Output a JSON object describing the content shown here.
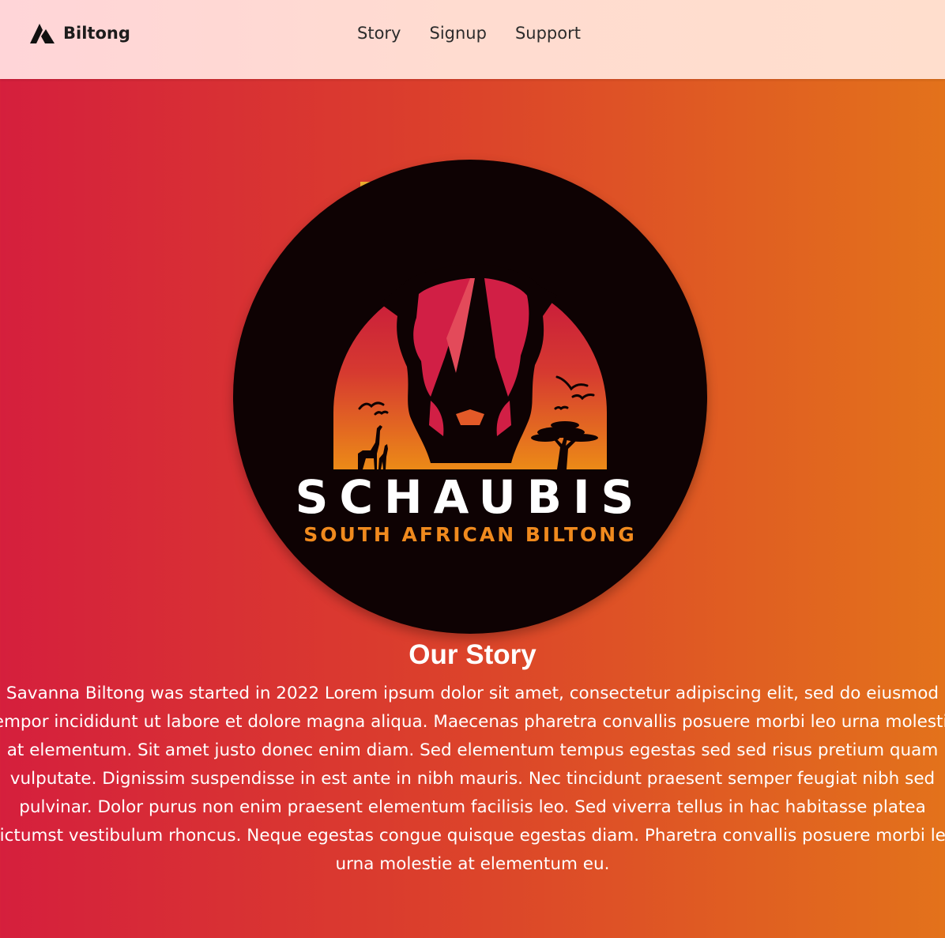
{
  "nav": {
    "brand": "Biltong",
    "links": [
      "Story",
      "Signup",
      "Support"
    ]
  },
  "logo": {
    "name": "SCHAUBIS",
    "tagline": "SOUTH AFRICAN BILTONG"
  },
  "story": {
    "title": "Our Story",
    "body": "Savanna Biltong was started in 2022 Lorem ipsum dolor sit amet, consectetur adipiscing elit, sed do eiusmod tempor incididunt ut labore et dolore magna aliqua. Maecenas pharetra convallis posuere morbi leo urna molestie at elementum. Sit amet justo donec enim diam. Sed elementum tempus egestas sed sed risus pretium quam vulputate. Dignissim suspendisse in est ante in nibh mauris. Nec tincidunt praesent semper feugiat nibh sed pulvinar. Dolor purus non enim praesent elementum facilisis leo. Sed viverra tellus in hac habitasse platea dictumst vestibulum rhoncus. Neque egestas congue quisque egestas diam. Pharetra convallis posuere morbi leo urna molestie at elementum eu."
  },
  "colors": {
    "gradient_start": "#d51f3d",
    "gradient_end": "#e3721b",
    "logo_background": "#0e0203",
    "logo_tagline": "#f08a1e",
    "navbar": "#ffd8d0"
  },
  "icons": {
    "brand": "mountain-logo-icon"
  }
}
